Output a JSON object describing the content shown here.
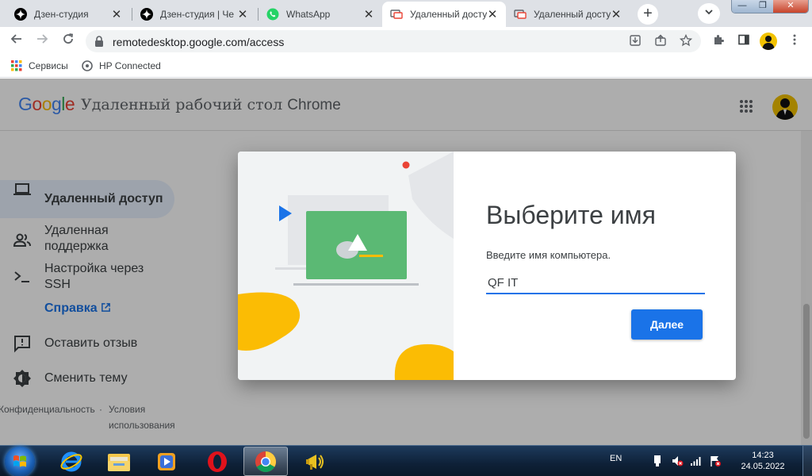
{
  "tabs": [
    {
      "title": "Дзен-студия",
      "icon": "zen-icon",
      "active": false
    },
    {
      "title": "Дзен-студия | Че",
      "icon": "zen-icon",
      "active": false
    },
    {
      "title": "WhatsApp",
      "icon": "whatsapp-icon",
      "active": false
    },
    {
      "title": "Удаленный досту",
      "icon": "remote-desktop-icon",
      "active": true
    },
    {
      "title": "Удаленный досту",
      "icon": "remote-desktop-icon",
      "active": false
    }
  ],
  "tab_close_glyph": "✕",
  "new_tab_glyph": "+",
  "window_controls": {
    "minimize": "—",
    "maximize": "❐",
    "close": "✕"
  },
  "address": {
    "url": "remotedesktop.google.com/access"
  },
  "bookmarks": [
    {
      "label": "Сервисы",
      "icon": "apps-grid-icon"
    },
    {
      "label": "HP Connected",
      "icon": "hp-icon"
    }
  ],
  "app": {
    "logo": "Google",
    "product": "Удаленный рабочий стол",
    "product_suffix": "Chrome"
  },
  "sidebar": {
    "items": [
      {
        "label": "Удаленный доступ",
        "icon": "laptop-icon",
        "active": true
      },
      {
        "label": "Удаленная поддержка",
        "icon": "people-icon",
        "active": false
      },
      {
        "label": "Настройка через SSH",
        "icon": "terminal-icon",
        "active": false
      },
      {
        "label": "Оставить отзыв",
        "icon": "feedback-icon",
        "active": false
      },
      {
        "label": "Сменить тему",
        "icon": "theme-icon",
        "active": false
      }
    ],
    "help": "Справка"
  },
  "footer": {
    "privacy": "Конфиденциальность",
    "dot": "·",
    "terms": "Условия использования"
  },
  "dialog": {
    "title": "Выберите имя",
    "label": "Введите имя компьютера.",
    "input_value": "QF IT",
    "next_button": "Далее"
  },
  "taskbar": {
    "language": "EN",
    "time": "14:23",
    "date": "24.05.2022"
  },
  "colors": {
    "accent": "#1a73e8",
    "illustration_green": "#5bb974",
    "illustration_yellow": "#fbbc04"
  }
}
